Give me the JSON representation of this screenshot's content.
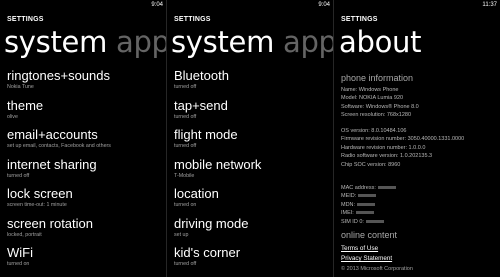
{
  "screen1": {
    "time": "9:04",
    "app_title": "SETTINGS",
    "pivot_active": "system",
    "pivot_next": "applica",
    "items": [
      {
        "title": "ringtones+sounds",
        "subtitle": "Nokia Tune"
      },
      {
        "title": "theme",
        "subtitle": "olive"
      },
      {
        "title": "email+accounts",
        "subtitle": "set up email, contacts, Facebook and others"
      },
      {
        "title": "internet sharing",
        "subtitle": "turned off"
      },
      {
        "title": "lock screen",
        "subtitle": "screen time-out: 1 minute"
      },
      {
        "title": "screen rotation",
        "subtitle": "locked, portrait"
      },
      {
        "title": "WiFi",
        "subtitle": "turned on"
      }
    ]
  },
  "screen2": {
    "time": "9:04",
    "app_title": "SETTINGS",
    "pivot_active": "system",
    "pivot_next": "applica",
    "items": [
      {
        "title": "Bluetooth",
        "subtitle": "turned off"
      },
      {
        "title": "tap+send",
        "subtitle": "turned off"
      },
      {
        "title": "flight mode",
        "subtitle": "turned off"
      },
      {
        "title": "mobile network",
        "subtitle": "T-Mobile"
      },
      {
        "title": "location",
        "subtitle": "turned on"
      },
      {
        "title": "driving mode",
        "subtitle": "set up"
      },
      {
        "title": "kid's corner",
        "subtitle": "turned off"
      }
    ]
  },
  "screen3": {
    "time": "11:37",
    "app_title": "SETTINGS",
    "page_title": "about",
    "phone_info_header": "phone information",
    "phone_info": [
      "Name: Windows Phone",
      "Model: NOKIA Lumia 920",
      "Software: Windows® Phone 8.0",
      "Screen resolution: 768x1280"
    ],
    "versions": [
      "OS version: 8.0.10484.106",
      "Firmware revision number: 3050.40000.1331.0000",
      "Hardware revision number: 1.0.0.0",
      "Radio software version: 1.0.202135.3",
      "Chip SOC version: 8960"
    ],
    "ids": [
      "MAC address:",
      "MEID:",
      "MDN:",
      "IMEI:",
      "SIM ID 0:"
    ],
    "online_header": "online content",
    "links": [
      "Terms of Use",
      "Privacy Statement"
    ],
    "copyright": "© 2013 Microsoft Corporation"
  }
}
